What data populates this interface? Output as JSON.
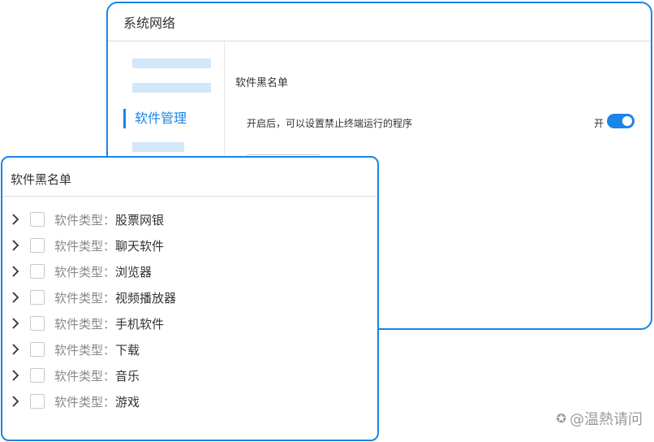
{
  "colors": {
    "accent": "#1a84e8",
    "placeholder": "#d3e7fb"
  },
  "back_window": {
    "title": "系统网络",
    "sidebar": {
      "active_item": "软件管理"
    },
    "content": {
      "section_title": "软件黑名单",
      "description": "开启后，可以设置禁止终端运行的程序",
      "toggle_label": "开",
      "toggle_on": true
    }
  },
  "front_window": {
    "title": "软件黑名单",
    "items": [
      {
        "label": "软件类型：",
        "value": "股票网银",
        "checked": false
      },
      {
        "label": "软件类型：",
        "value": "聊天软件",
        "checked": false
      },
      {
        "label": "软件类型：",
        "value": "浏览器",
        "checked": false
      },
      {
        "label": "软件类型：",
        "value": "视频播放器",
        "checked": false
      },
      {
        "label": "软件类型：",
        "value": "手机软件",
        "checked": false
      },
      {
        "label": "软件类型：",
        "value": "下载",
        "checked": false
      },
      {
        "label": "软件类型：",
        "value": "音乐",
        "checked": false
      },
      {
        "label": "软件类型：",
        "value": "游戏",
        "checked": false
      }
    ]
  },
  "watermark": {
    "text": "@温熱请问",
    "icon": "watermark-logo-icon"
  }
}
